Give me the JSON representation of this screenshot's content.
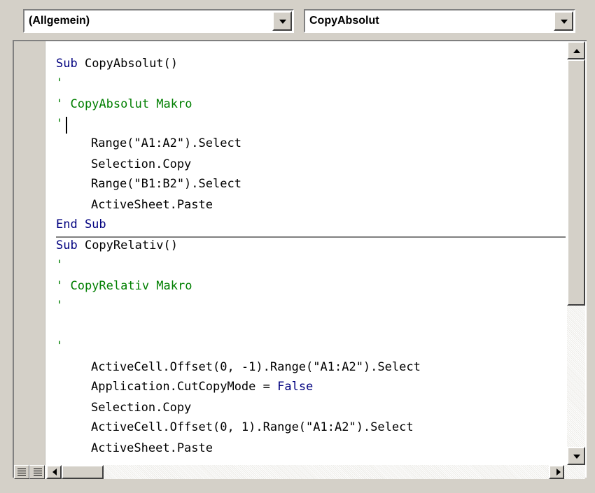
{
  "object_combo": {
    "value": "(Allgemein)"
  },
  "procedure_combo": {
    "value": "CopyAbsolut"
  },
  "code_lines": [
    {
      "kw1": "Sub",
      "text": " CopyAbsolut()"
    },
    {
      "cm": "'"
    },
    {
      "cm": "' CopyAbsolut Makro"
    },
    {
      "cm": "'"
    },
    {
      "text": "Range(\"A1:A2\").Select"
    },
    {
      "text": "Selection.Copy"
    },
    {
      "text": "Range(\"B1:B2\").Select"
    },
    {
      "text": "ActiveSheet.Paste"
    },
    {
      "kw1": "End Sub"
    },
    {
      "kw1": "Sub",
      "text": " CopyRelativ()"
    },
    {
      "cm": "'"
    },
    {
      "cm": "' CopyRelativ Makro"
    },
    {
      "cm": "'"
    },
    {
      "cm": "'"
    },
    {
      "text": "ActiveCell.Offset(0, -1).Range(\"A1:A2\").Select"
    },
    {
      "text": "Application.CutCopyMode = ",
      "kw2": "False"
    },
    {
      "text": "Selection.Copy"
    },
    {
      "text": "ActiveCell.Offset(0, 1).Range(\"A1:A2\").Select"
    },
    {
      "text": "ActiveSheet.Paste"
    }
  ],
  "colors": {
    "keyword": "#00007f",
    "comment": "#007f00",
    "text": "#000000",
    "chrome": "#d4d0c8"
  }
}
